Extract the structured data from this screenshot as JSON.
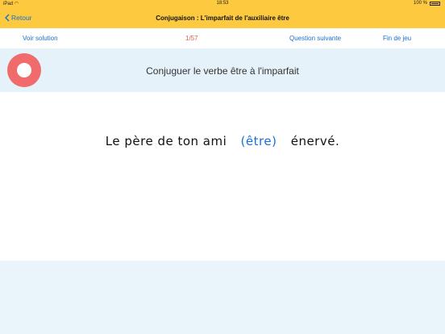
{
  "status_bar": {
    "device": "iPad",
    "time": "18:53",
    "battery": "100 %"
  },
  "nav": {
    "back_label": "Retour",
    "title": "Conjugaison : L'imparfait de l'auxiliaire être"
  },
  "toolbar": {
    "solution_label": "Voir solution",
    "counter": "1/57",
    "next_label": "Question suivante",
    "end_label": "Fin de jeu"
  },
  "instruction": "Conjuguer le verbe être à l'imparfait",
  "sentence": {
    "before": "Le père de ton ami",
    "verb": "(être)",
    "after": "énervé."
  },
  "colors": {
    "header": "#fcc93f",
    "link": "#1a6fd3",
    "counter": "#e05a4f",
    "ring": "#f06b6b"
  }
}
